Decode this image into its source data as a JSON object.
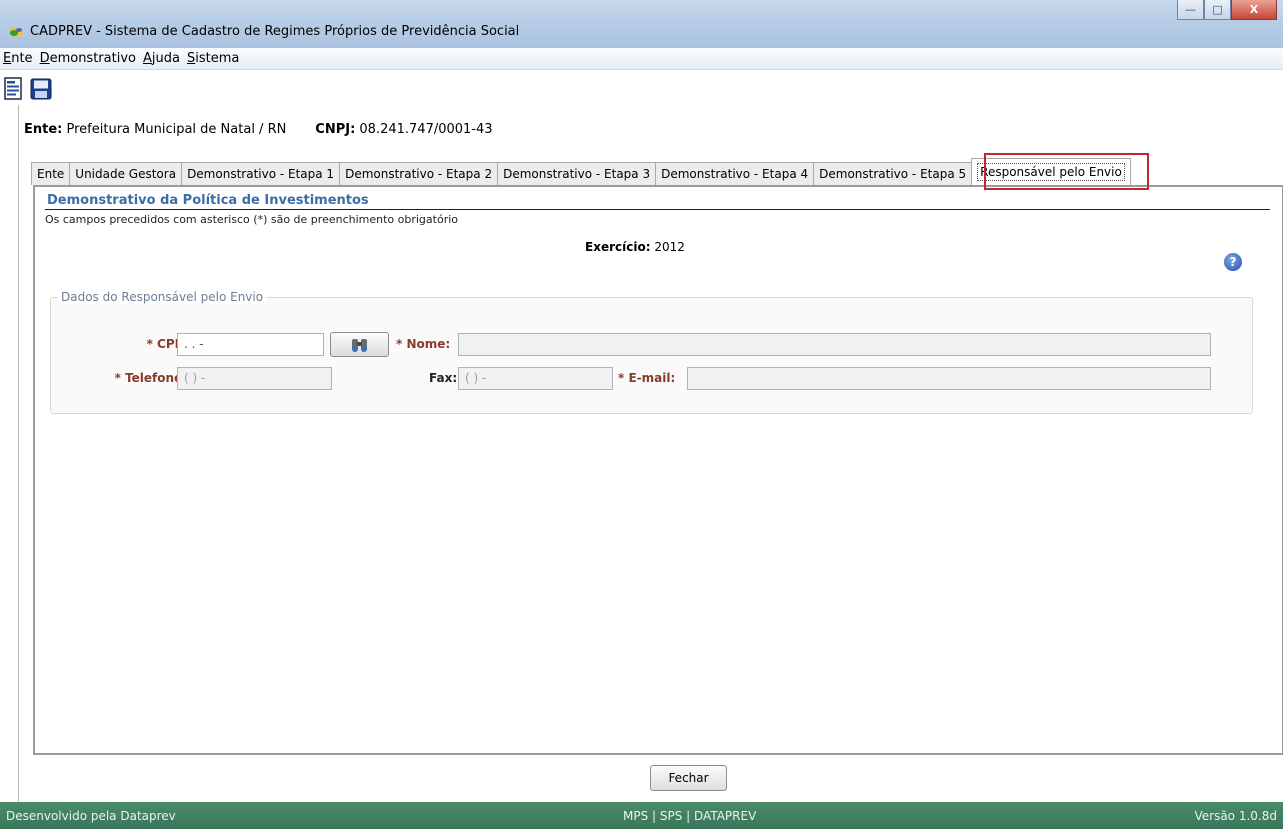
{
  "window": {
    "title": "CADPREV - Sistema de Cadastro de Regimes Próprios de Previdência Social",
    "controls": {
      "minimize": "—",
      "maximize": "□",
      "close": "X"
    }
  },
  "menu": [
    "Ente",
    "Demonstrativo",
    "Ajuda",
    "Sistema"
  ],
  "toolbar": {
    "report_icon": "report-icon",
    "save_icon": "floppy-disk-icon"
  },
  "ente": {
    "label": "Ente:",
    "value": "Prefeitura Municipal de Natal / RN",
    "cnpj_label": "CNPJ:",
    "cnpj_value": "08.241.747/0001-43"
  },
  "tabs": [
    "Ente",
    "Unidade Gestora",
    "Demonstrativo - Etapa 1",
    "Demonstrativo - Etapa 2",
    "Demonstrativo - Etapa 3",
    "Demonstrativo - Etapa 4",
    "Demonstrativo - Etapa 5",
    "Responsável pelo Envio"
  ],
  "panel": {
    "heading": "Demonstrativo da Política de Investimentos",
    "note": "Os campos precedidos com asterisco (*) são de preenchimento obrigatório",
    "exercicio_label": "Exercício:",
    "exercicio_value": "2012",
    "help_glyph": "?"
  },
  "form": {
    "legend": "Dados do Responsável pelo Envio",
    "cpf_label": "* CPF:",
    "cpf_value": " .  .  -",
    "nome_label": "* Nome:",
    "nome_value": "",
    "telefone_label": "* Telefone:",
    "telefone_value": "( )  -",
    "fax_label": "Fax:",
    "fax_value": "( )  -",
    "email_label": "* E-mail:",
    "email_value": ""
  },
  "buttons": {
    "fechar": "Fechar"
  },
  "status": {
    "left": "Desenvolvido pela Dataprev",
    "center": "MPS | SPS | DATAPREV",
    "right": "Versão 1.0.8d"
  },
  "colors": {
    "title_bar": "#b7cde6",
    "status_bar": "#3f7d5f",
    "heading_blue": "#3a6ea5",
    "required_label": "#8a3a2a",
    "tab_highlight": "#c0282e"
  }
}
